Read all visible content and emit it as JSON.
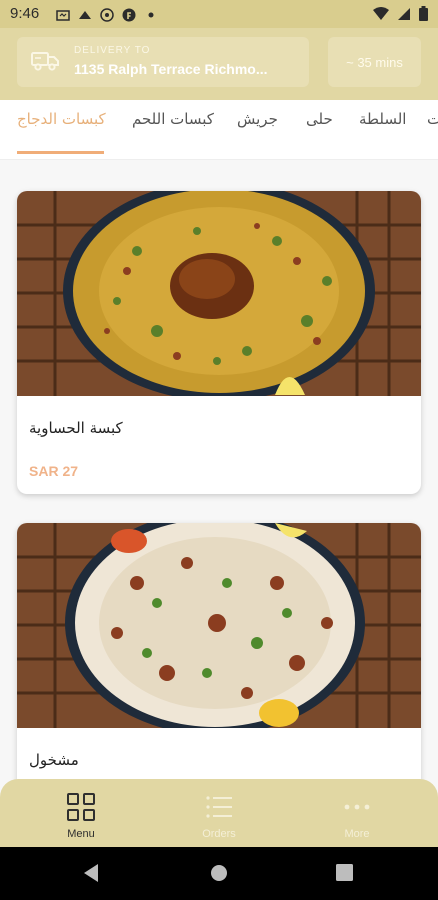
{
  "status_bar": {
    "time": "9:46",
    "left_icons": [
      "media-icon",
      "notification-icon",
      "sync-icon",
      "f-icon",
      "dot-icon"
    ],
    "right_icons": [
      "wifi-icon",
      "signal-icon",
      "battery-icon"
    ]
  },
  "header": {
    "delivery_label": "DELIVERY TO",
    "delivery_address": "1135 Ralph Terrace Richmo...",
    "eta": "~ 35 mins",
    "icon": "delivery-truck-icon"
  },
  "categories": [
    {
      "label": "كبسات الدجاج",
      "active": true
    },
    {
      "label": "كبسات اللحم",
      "active": false
    },
    {
      "label": "جريش",
      "active": false
    },
    {
      "label": "حلى",
      "active": false
    },
    {
      "label": "السلطة",
      "active": false
    },
    {
      "label": "ت",
      "active": false
    }
  ],
  "menu_items": [
    {
      "name": "كبسة الحساوية",
      "price": "SAR 27"
    },
    {
      "name": "مشخول",
      "price": ""
    }
  ],
  "bottom_nav": [
    {
      "label": "Menu",
      "icon": "grid-icon",
      "active": true
    },
    {
      "label": "Orders",
      "icon": "list-icon",
      "active": false
    },
    {
      "label": "More",
      "icon": "more-dots-icon",
      "active": false
    }
  ],
  "colors": {
    "brand": "#e1d7a3",
    "accent": "#f0ad78",
    "price": "#f0b38a"
  }
}
